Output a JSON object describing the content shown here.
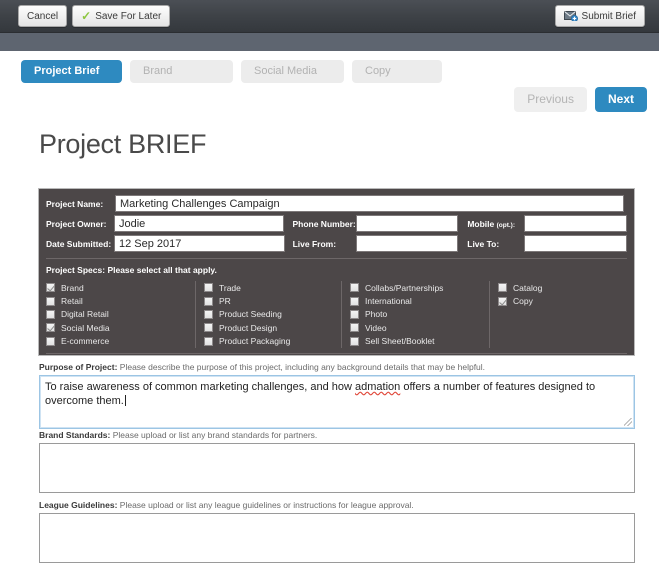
{
  "toolbar": {
    "cancel_label": "Cancel",
    "save_label": "Save For Later",
    "submit_label": "Submit Brief"
  },
  "tabs": [
    {
      "label": "Project Brief",
      "active": true
    },
    {
      "label": "Brand",
      "active": false
    },
    {
      "label": "Social Media",
      "active": false
    },
    {
      "label": "Copy",
      "active": false
    }
  ],
  "pagination": {
    "previous_label": "Previous",
    "next_label": "Next"
  },
  "page": {
    "title": "Project BRIEF"
  },
  "form": {
    "project_name": {
      "label": "Project Name:",
      "value": "Marketing Challenges Campaign"
    },
    "project_owner": {
      "label": "Project Owner:",
      "value": "Jodie"
    },
    "date_submitted": {
      "label": "Date Submitted:",
      "value": "12 Sep 2017"
    },
    "phone_number": {
      "label": "Phone Number:",
      "value": ""
    },
    "mobile": {
      "label": "Mobile",
      "label_optional": "(opt.):",
      "value": ""
    },
    "live_from": {
      "label": "Live From:",
      "value": ""
    },
    "live_to": {
      "label": "Live To:",
      "value": ""
    }
  },
  "specs": {
    "title": "Project Specs:",
    "subtitle": "Please select all that apply.",
    "columns": [
      [
        {
          "label": "Brand",
          "checked": true
        },
        {
          "label": "Retail",
          "checked": false
        },
        {
          "label": "Digital Retail",
          "checked": false
        },
        {
          "label": "Social Media",
          "checked": true
        },
        {
          "label": "E-commerce",
          "checked": false
        }
      ],
      [
        {
          "label": "Trade",
          "checked": false
        },
        {
          "label": "PR",
          "checked": false
        },
        {
          "label": "Product Seeding",
          "checked": false
        },
        {
          "label": "Product Design",
          "checked": false
        },
        {
          "label": "Product Packaging",
          "checked": false
        }
      ],
      [
        {
          "label": "Collabs/Partnerships",
          "checked": false
        },
        {
          "label": "International",
          "checked": false
        },
        {
          "label": "Photo",
          "checked": false
        },
        {
          "label": "Video",
          "checked": false
        },
        {
          "label": "Sell Sheet/Booklet",
          "checked": false
        }
      ],
      [
        {
          "label": "Catalog",
          "checked": false
        },
        {
          "label": "Copy",
          "checked": true
        }
      ]
    ]
  },
  "sections": {
    "purpose": {
      "label": "Purpose of Project:",
      "hint": "Please describe the purpose of this project, including any background details that may be helpful.",
      "value_before": "To raise awareness of common marketing challenges, and how ",
      "value_misspelled": "admation",
      "value_after": " offers a number of features designed to overcome them.",
      "focused": true
    },
    "brand_standards": {
      "label": "Brand Standards:",
      "hint": "Please upload or list any brand standards for partners.",
      "value": ""
    },
    "league_guidelines": {
      "label": "League Guidelines:",
      "hint": "Please upload or list any league guidelines or instructions for league approval.",
      "value": ""
    }
  },
  "colors": {
    "accent": "#2e8ac0",
    "toolbar_dark": "#3e4247",
    "subbar": "#5e6570",
    "panel": "#4c4748",
    "check_green": "#8cc63f"
  }
}
